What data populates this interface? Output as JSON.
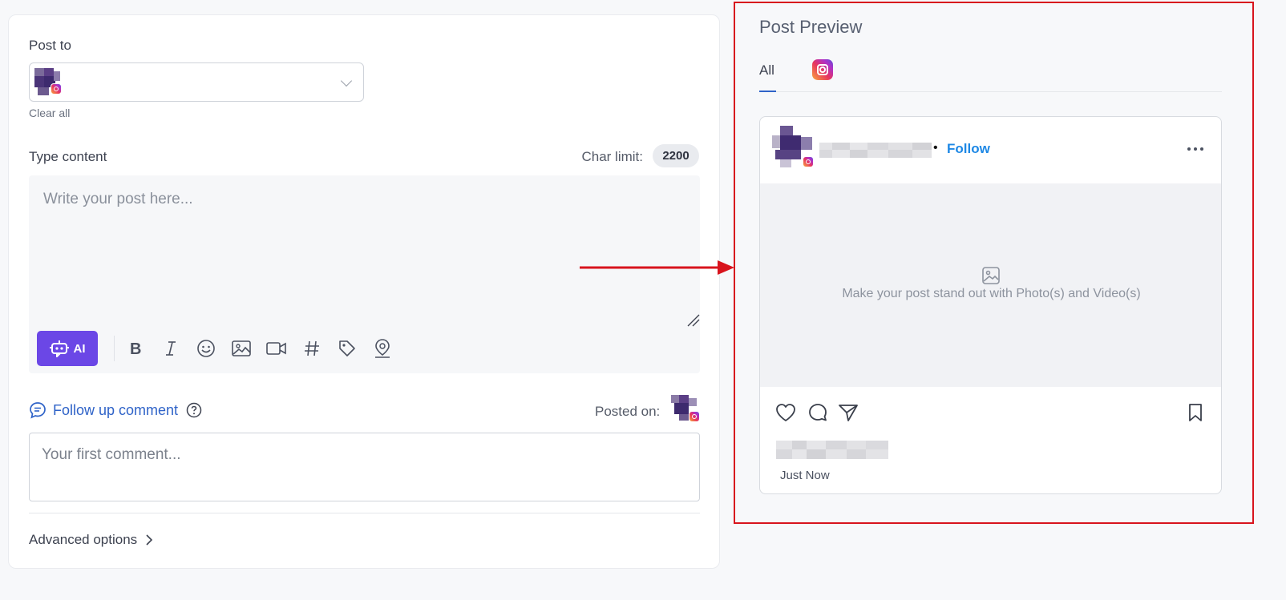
{
  "composer": {
    "post_to_label": "Post to",
    "clear_all": "Clear all",
    "type_content_label": "Type content",
    "char_limit_label": "Char limit:",
    "char_limit_value": "2200",
    "editor_placeholder": "Write your post here...",
    "ai_button_label": "AI",
    "toolbar_icons": [
      "bold-icon",
      "italic-icon",
      "emoji-icon",
      "image-icon",
      "video-icon",
      "hashtag-icon",
      "tag-icon",
      "location-icon"
    ],
    "follow_up_comment": "Follow up comment",
    "posted_on_label": "Posted on:",
    "comment_placeholder": "Your first comment...",
    "advanced_options": "Advanced options"
  },
  "preview": {
    "title": "Post Preview",
    "tabs": [
      {
        "label": "All",
        "active": true
      },
      {
        "label": "",
        "icon": "instagram-icon"
      }
    ],
    "card": {
      "follow_label": "Follow",
      "dot": "•",
      "media_placeholder": "Make your post stand out with Photo(s) and Video(s)",
      "timestamp": "Just Now"
    }
  },
  "colors": {
    "accent_blue": "#2f63c8",
    "ai_purple": "#6b47e6",
    "follow_blue": "#1e88e5",
    "highlight_red": "#d8141d"
  }
}
